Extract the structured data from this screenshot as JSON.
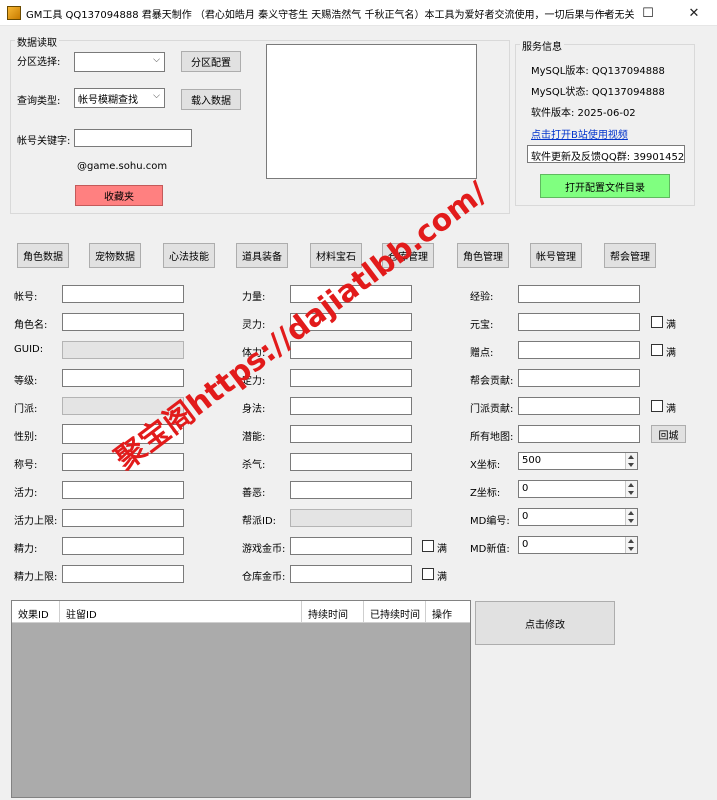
{
  "window": {
    "title": "GM工具 QQ137094888 君暴天制作 （君心如皓月 秦义守苍生 天赐浩然气 千秋正气名）本工具为爱好者交流使用，一切后果与作者无关",
    "minimize": "—",
    "maximize": "☐",
    "close": "✕"
  },
  "data_read": {
    "legend": "数据读取",
    "zone_label": "分区选择:",
    "zone_value": "",
    "zone_config_button": "分区配置",
    "query_type_label": "查询类型:",
    "query_type_value": "帐号模糊查找",
    "load_button": "载入数据",
    "keyword_label": "帐号关键字:",
    "keyword_value": "",
    "suffix": "@game.sohu.com",
    "favorites_button": "收藏夹"
  },
  "service": {
    "legend": "服务信息",
    "mysql_version": "MySQL版本:   QQ137094888",
    "mysql_status": "MySQL状态:   QQ137094888",
    "software_version": "软件版本:   2025-06-02",
    "bilibili_link": "点击打开B站使用视频",
    "update_group": "软件更新及反馈QQ群: 399014524",
    "open_config_button": "打开配置文件目录"
  },
  "tabs": [
    "角色数据",
    "宠物数据",
    "心法技能",
    "道具装备",
    "材料宝石",
    "仓库管理",
    "角色管理",
    "帐号管理",
    "帮会管理"
  ],
  "fields": {
    "c1": [
      "帐号:",
      "角色名:",
      "GUID:",
      "等级:",
      "门派:",
      "性别:",
      "称号:",
      "活力:",
      "活力上限:",
      "精力:",
      "精力上限:"
    ],
    "c2": [
      "力量:",
      "灵力:",
      "体力:",
      "定力:",
      "身法:",
      "潜能:",
      "杀气:",
      "善恶:",
      "帮派ID:",
      "游戏金币:",
      "仓库金币:"
    ],
    "c3": [
      "经验:",
      "元宝:",
      "赠点:",
      "帮会贡献:",
      "门派贡献:",
      "所有地图:",
      "X坐标:",
      "Z坐标:",
      "MD编号:",
      "MD新值:"
    ]
  },
  "full_label": "满",
  "return_city_button": "回城",
  "spinners": {
    "x": "500",
    "z": "0",
    "md_no": "0",
    "md_new": "0"
  },
  "effects_table": {
    "columns": [
      "效果ID",
      "驻留ID",
      "持续时间",
      "已持续时间",
      "操作"
    ]
  },
  "modify_button": "点击修改",
  "watermark": "聚宝阁https://dajiatlbb.com/"
}
